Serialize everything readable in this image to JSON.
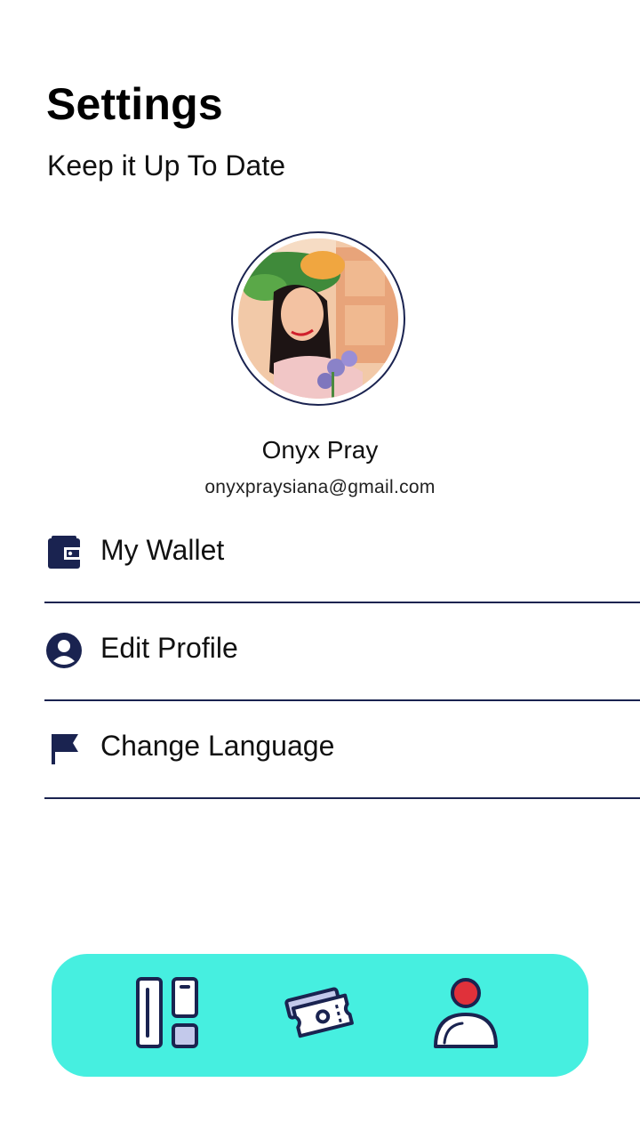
{
  "header": {
    "title": "Settings",
    "subtitle": "Keep it Up To Date"
  },
  "profile": {
    "name": "Onyx Pray",
    "email": "onyxpraysiana@gmail.com"
  },
  "menu": [
    {
      "label": "My Wallet",
      "icon": "wallet-icon"
    },
    {
      "label": "Edit Profile",
      "icon": "user-circle-icon"
    },
    {
      "label": "Change Language",
      "icon": "flag-icon"
    }
  ],
  "bottom_nav": {
    "items": [
      {
        "icon": "dashboard-icon"
      },
      {
        "icon": "ticket-icon"
      },
      {
        "icon": "profile-icon",
        "active": true
      }
    ],
    "background": "#46efe0"
  },
  "colors": {
    "accent": "#1a2350",
    "nav": "#46efe0",
    "active_dot": "#e0313a"
  }
}
